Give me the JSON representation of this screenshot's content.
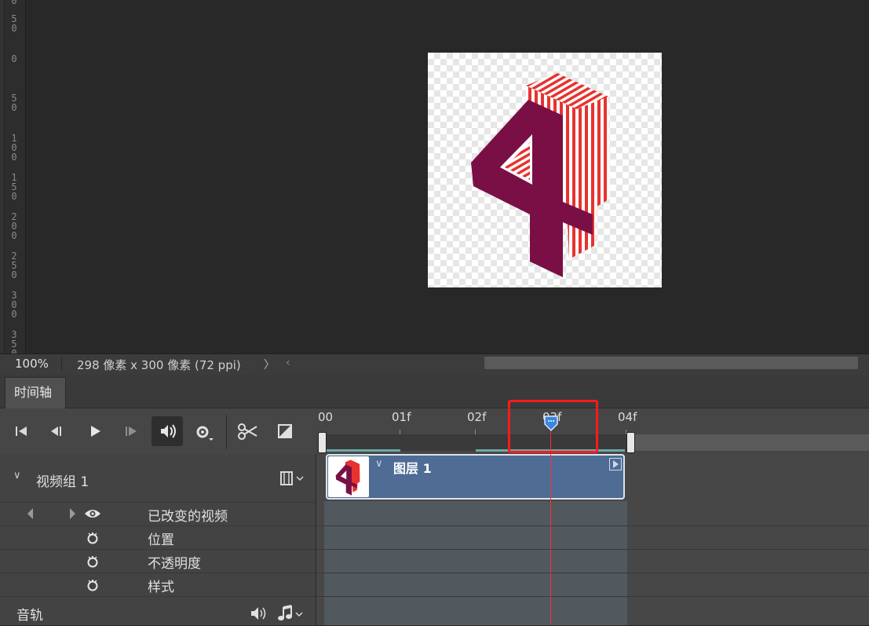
{
  "status": {
    "zoom": "100%",
    "doc_info": "298 像素 x 300 像素 (72 ppi)"
  },
  "ruler_labels": [
    "0",
    "5\n0",
    "0",
    "5\n0",
    "1\n0\n0",
    "1\n5\n0",
    "2\n0\n0",
    "2\n5\n0",
    "3\n0\n0",
    "3\n5\n0"
  ],
  "timeline": {
    "tab_label": "时间轴",
    "ticks": [
      "00",
      "01f",
      "02f",
      "03f",
      "04f"
    ],
    "playhead_frame": "03f",
    "video_group": "视频组 1",
    "layer_name": "图层 1",
    "properties": [
      "已改变的视频",
      "位置",
      "不透明度",
      "样式"
    ],
    "audio_track": "音轨"
  },
  "colors": {
    "clip": "#4f6c95",
    "playhead": "#ff2d2d",
    "highlight_box": "#ff1a1a",
    "digit_dark": "#7a0f45",
    "digit_stripe": "#e8322e"
  }
}
